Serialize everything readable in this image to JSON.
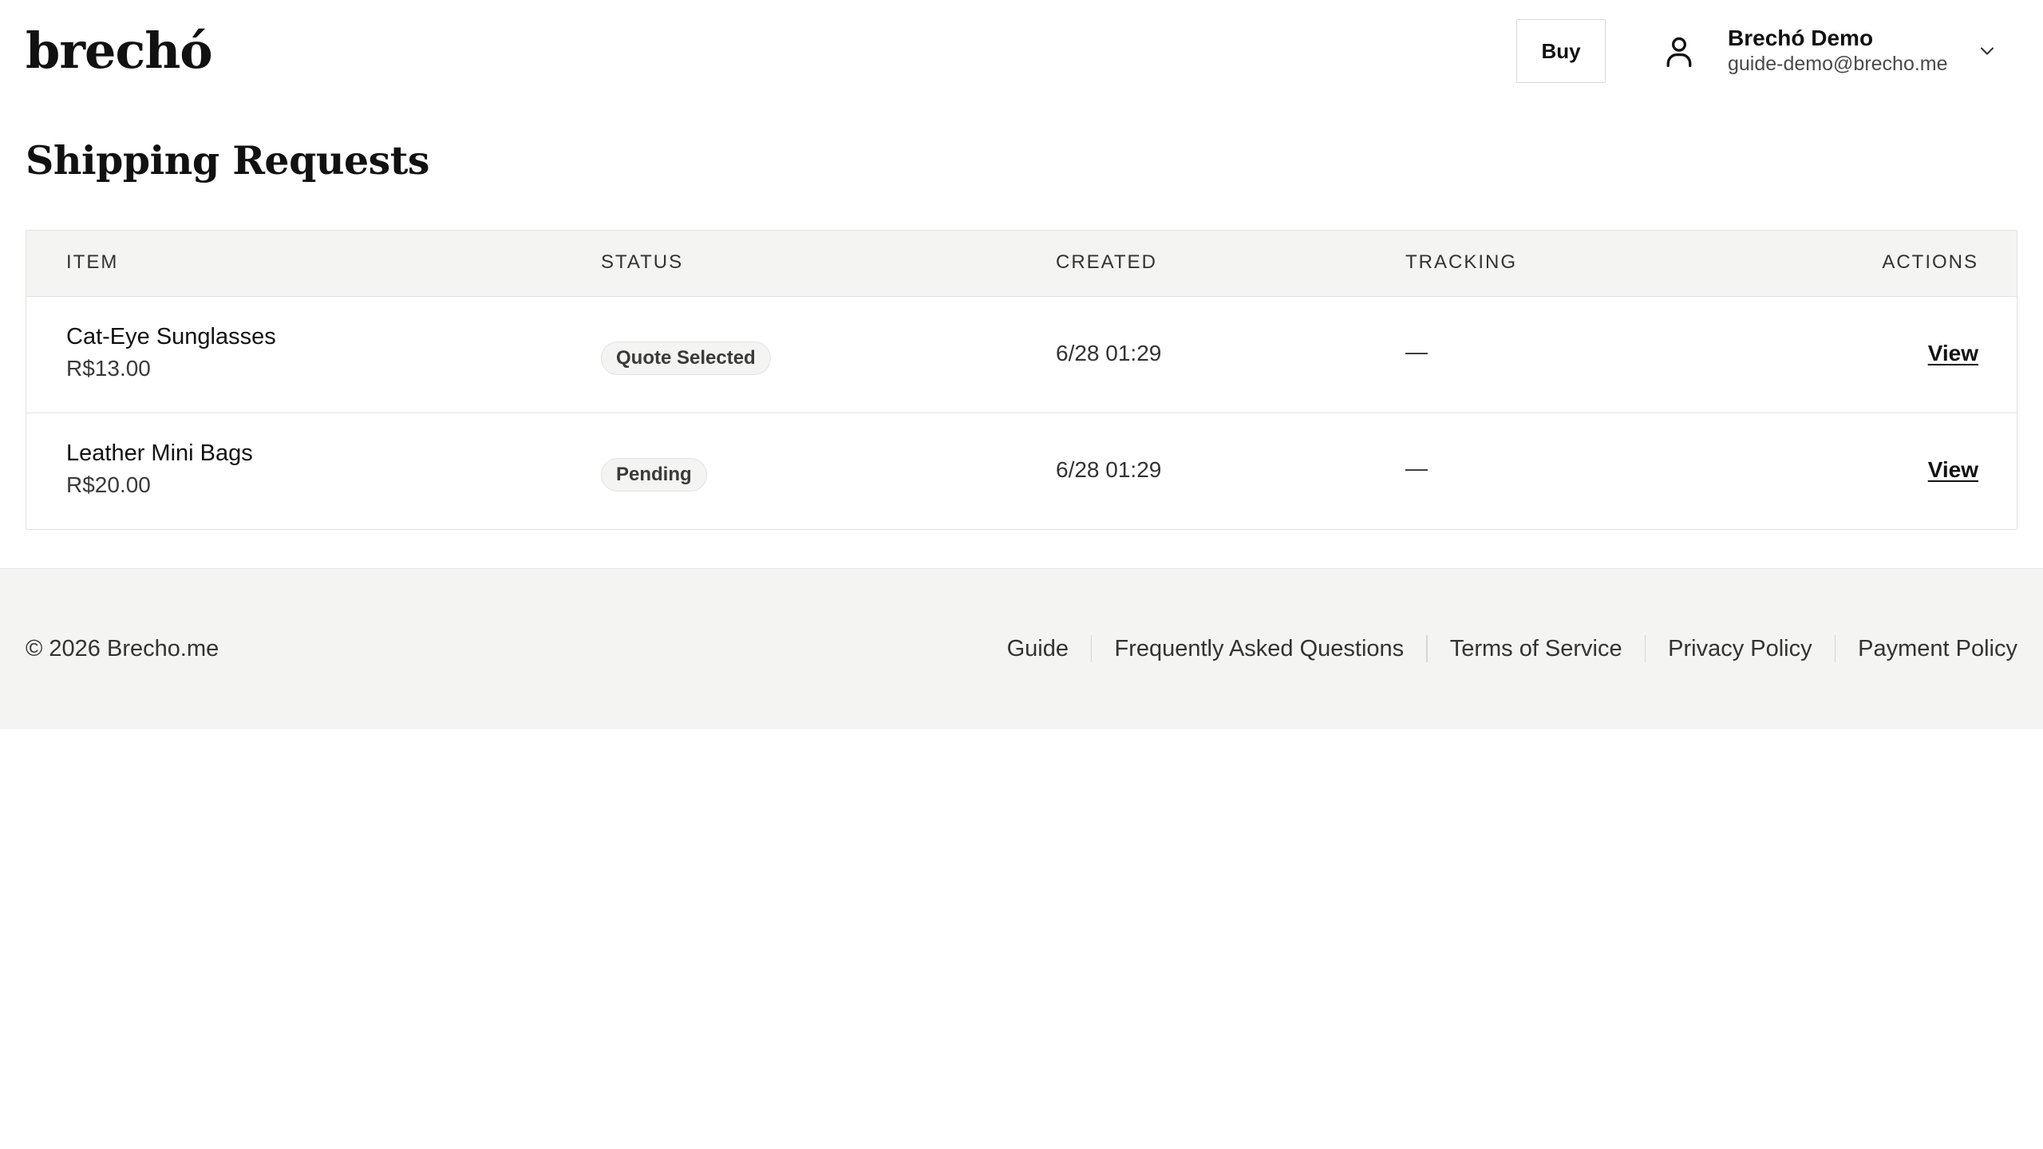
{
  "header": {
    "logo": "brechó",
    "buy_label": "Buy",
    "user": {
      "name": "Brechó Demo",
      "email": "guide-demo@brecho.me"
    }
  },
  "page": {
    "title": "Shipping Requests"
  },
  "table": {
    "columns": {
      "item": "ITEM",
      "status": "STATUS",
      "created": "CREATED",
      "tracking": "TRACKING",
      "actions": "ACTIONS"
    },
    "rows": [
      {
        "name": "Cat-Eye Sunglasses",
        "price": "R$13.00",
        "status": "Quote Selected",
        "created": "6/28 01:29",
        "tracking": "—",
        "action": "View"
      },
      {
        "name": "Leather Mini Bags",
        "price": "R$20.00",
        "status": "Pending",
        "created": "6/28 01:29",
        "tracking": "—",
        "action": "View"
      }
    ]
  },
  "footer": {
    "copyright": "© 2026 Brecho.me",
    "links": [
      "Guide",
      "Frequently Asked Questions",
      "Terms of Service",
      "Privacy Policy",
      "Payment Policy"
    ]
  },
  "icons": {
    "user": "user-icon",
    "chevron": "chevron-down-icon"
  }
}
